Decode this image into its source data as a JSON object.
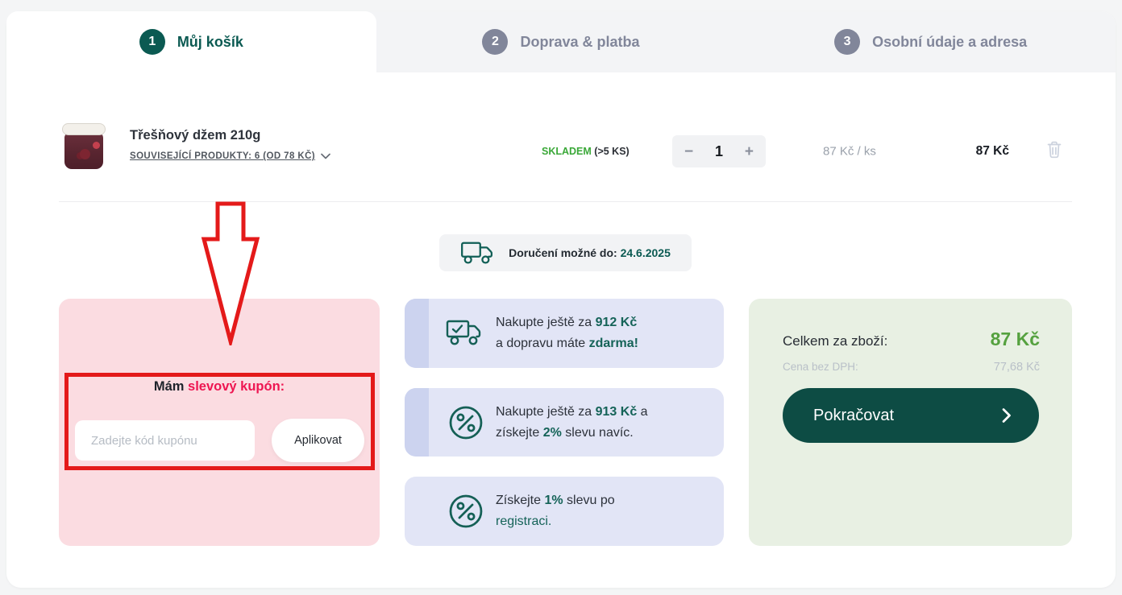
{
  "colors": {
    "accent_teal": "#0b5a52",
    "promo_teal": "#156358",
    "button_teal": "#0d4c44",
    "green": "#55a13f",
    "pink_accent": "#ee1551",
    "annotation_red": "#e41a1a",
    "stock_green": "#3aa838"
  },
  "tabs": [
    {
      "number": "1",
      "label": "Můj košík"
    },
    {
      "number": "2",
      "label": "Doprava & platba"
    },
    {
      "number": "3",
      "label": "Osobní údaje a adresa"
    }
  ],
  "product": {
    "title": "Třešňový džem 210g",
    "related_link": "SOUVISEJÍCÍ PRODUKTY: 6 (OD 78 KČ)",
    "stock_status": "SKLADEM",
    "stock_detail": "(>5 KS)",
    "minus": "−",
    "quantity": "1",
    "plus": "+",
    "unit_price": "87 Kč / ks",
    "total_price": "87 Kč"
  },
  "delivery": {
    "label": "Doručení možné do:",
    "date": "24.6.2025"
  },
  "coupon": {
    "title_plain": "Mám ",
    "title_accent": "slevový kupón:",
    "placeholder": "Zadejte kód kupónu",
    "apply_label": "Aplikovat"
  },
  "promos": [
    {
      "icon": "truck-check-icon",
      "accent_strip": true,
      "segments": [
        {
          "text": "Nakupte ještě za ",
          "style": "plain"
        },
        {
          "text": "912 Kč",
          "style": "accent-bold"
        },
        {
          "text": "\na dopravu máte ",
          "style": "plain"
        },
        {
          "text": "zdarma!",
          "style": "accent-bold"
        }
      ]
    },
    {
      "icon": "percent-icon",
      "accent_strip": true,
      "segments": [
        {
          "text": "Nakupte ještě za ",
          "style": "plain"
        },
        {
          "text": "913 Kč",
          "style": "accent-bold"
        },
        {
          "text": " a\nzískejte ",
          "style": "plain"
        },
        {
          "text": "2%",
          "style": "accent-bold"
        },
        {
          "text": " slevu navíc.",
          "style": "plain"
        }
      ]
    },
    {
      "icon": "percent-icon",
      "accent_strip": false,
      "segments": [
        {
          "text": "Získejte ",
          "style": "plain"
        },
        {
          "text": "1%",
          "style": "accent-bold"
        },
        {
          "text": " slevu po\n",
          "style": "plain"
        },
        {
          "text": "registraci.",
          "style": "link"
        }
      ]
    }
  ],
  "summary": {
    "total_label": "Celkem za zboží:",
    "total_value": "87 Kč",
    "vat_label": "Cena bez DPH:",
    "vat_value": "77,68 Kč",
    "continue_label": "Pokračovat"
  }
}
